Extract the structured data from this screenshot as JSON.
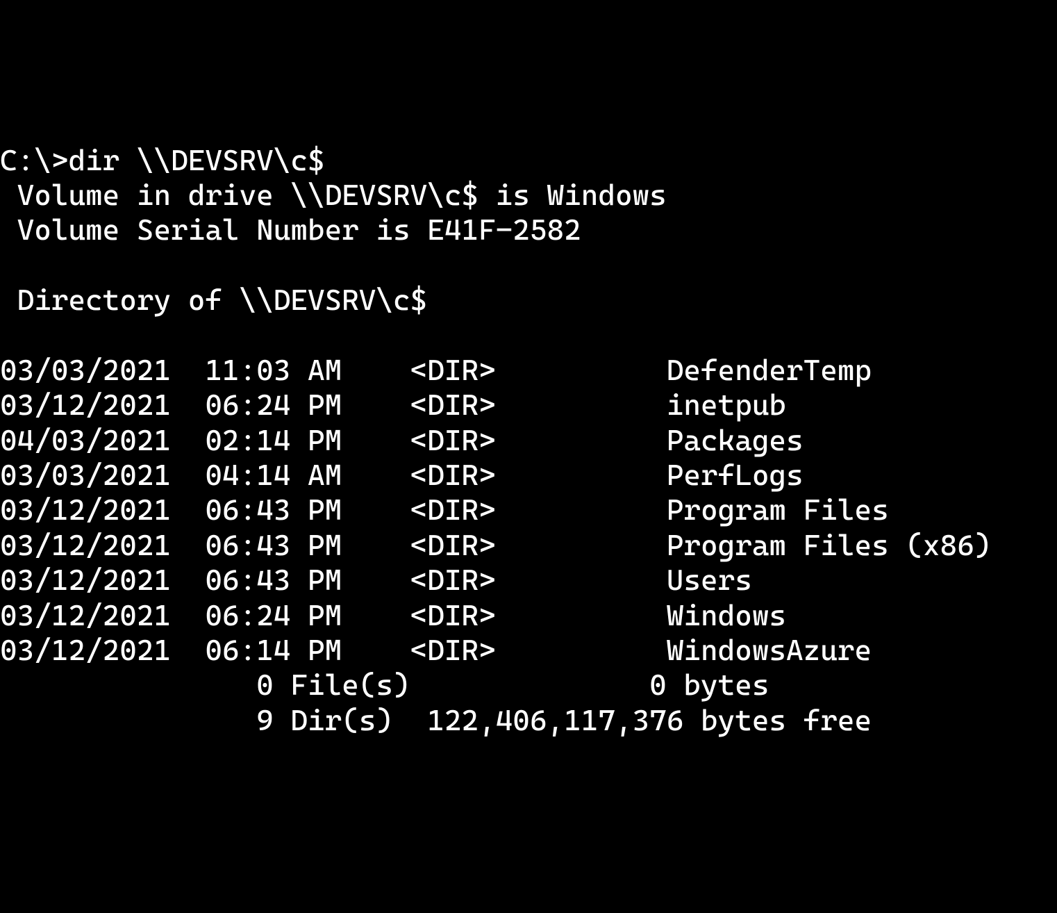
{
  "prompt": "C:\\>",
  "command": "dir \\\\DEVSRV\\c$",
  "volume_line": " Volume in drive \\\\DEVSRV\\c$ is Windows",
  "serial_line": " Volume Serial Number is E41F-2582",
  "blank": "",
  "directory_of": " Directory of \\\\DEVSRV\\c$",
  "entries": [
    {
      "date": "03/03/2021",
      "time": "11:03 AM",
      "type": "<DIR>",
      "size": "",
      "name": "DefenderTemp"
    },
    {
      "date": "03/12/2021",
      "time": "06:24 PM",
      "type": "<DIR>",
      "size": "",
      "name": "inetpub"
    },
    {
      "date": "04/03/2021",
      "time": "02:14 PM",
      "type": "<DIR>",
      "size": "",
      "name": "Packages"
    },
    {
      "date": "03/03/2021",
      "time": "04:14 AM",
      "type": "<DIR>",
      "size": "",
      "name": "PerfLogs"
    },
    {
      "date": "03/12/2021",
      "time": "06:43 PM",
      "type": "<DIR>",
      "size": "",
      "name": "Program Files"
    },
    {
      "date": "03/12/2021",
      "time": "06:43 PM",
      "type": "<DIR>",
      "size": "",
      "name": "Program Files (x86)"
    },
    {
      "date": "03/12/2021",
      "time": "06:43 PM",
      "type": "<DIR>",
      "size": "",
      "name": "Users"
    },
    {
      "date": "03/12/2021",
      "time": "06:24 PM",
      "type": "<DIR>",
      "size": "",
      "name": "Windows"
    },
    {
      "date": "03/12/2021",
      "time": "06:14 PM",
      "type": "<DIR>",
      "size": "",
      "name": "WindowsAzure"
    }
  ],
  "summary_files": "               0 File(s)              0 bytes",
  "summary_dirs": "               9 Dir(s)  122,406,117,376 bytes free"
}
